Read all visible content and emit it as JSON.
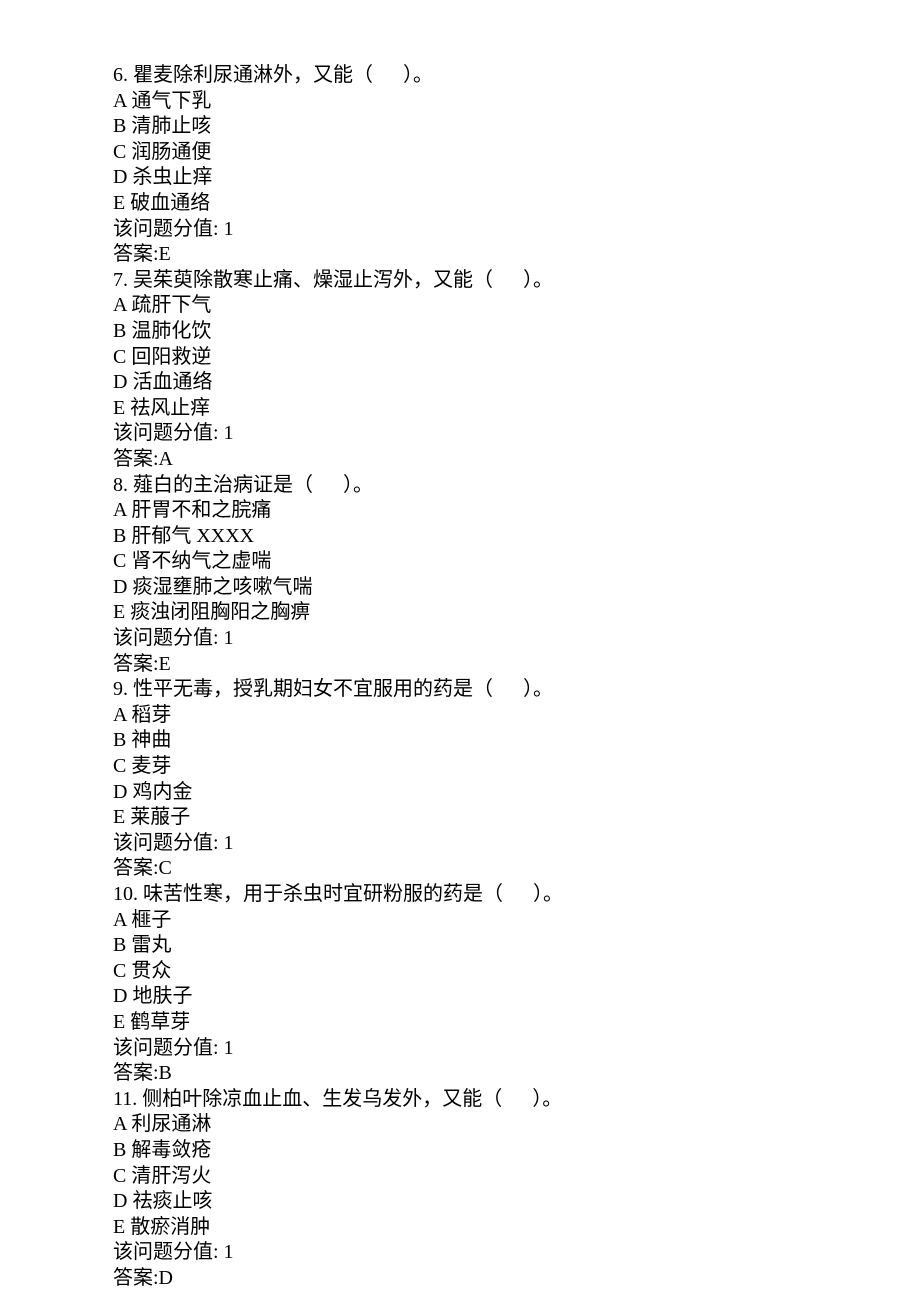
{
  "questions": [
    {
      "number": "6.",
      "stem": "瞿麦除利尿通淋外，又能（      ）。",
      "options": {
        "A": "通气下乳",
        "B": "清肺止咳",
        "C": "润肠通便",
        "D": "杀虫止痒",
        "E": "破血通络"
      },
      "score_label": "该问题分值: 1",
      "answer_label": "答案:E"
    },
    {
      "number": "7.",
      "stem": "吴茱萸除散寒止痛、燥湿止泻外，又能（      ）。",
      "options": {
        "A": "疏肝下气",
        "B": "温肺化饮",
        "C": "回阳救逆",
        "D": "活血通络",
        "E": "祛风止痒"
      },
      "score_label": "该问题分值: 1",
      "answer_label": "答案:A"
    },
    {
      "number": "8.",
      "stem": "薤白的主治病证是（      ）。",
      "options": {
        "A": "肝胃不和之脘痛",
        "B": "肝郁气 XXXX",
        "C": "肾不纳气之虚喘",
        "D": "痰湿壅肺之咳嗽气喘",
        "E": "痰浊闭阻胸阳之胸痹"
      },
      "score_label": "该问题分值: 1",
      "answer_label": "答案:E"
    },
    {
      "number": "9.",
      "stem": "性平无毒，授乳期妇女不宜服用的药是（      ）。",
      "options": {
        "A": "稻芽",
        "B": "神曲",
        "C": "麦芽",
        "D": "鸡内金",
        "E": "莱菔子"
      },
      "score_label": "该问题分值: 1",
      "answer_label": "答案:C"
    },
    {
      "number": "10.",
      "stem": "味苦性寒，用于杀虫时宜研粉服的药是（      ）。",
      "options": {
        "A": "榧子",
        "B": "雷丸",
        "C": "贯众",
        "D": "地肤子",
        "E": "鹤草芽"
      },
      "score_label": "该问题分值: 1",
      "answer_label": "答案:B"
    },
    {
      "number": "11.",
      "stem": "侧柏叶除凉血止血、生发乌发外，又能（      ）。",
      "options": {
        "A": "利尿通淋",
        "B": "解毒敛疮",
        "C": "清肝泻火",
        "D": "祛痰止咳",
        "E": "散瘀消肿"
      },
      "score_label": "该问题分值: 1",
      "answer_label": "答案:D"
    }
  ]
}
